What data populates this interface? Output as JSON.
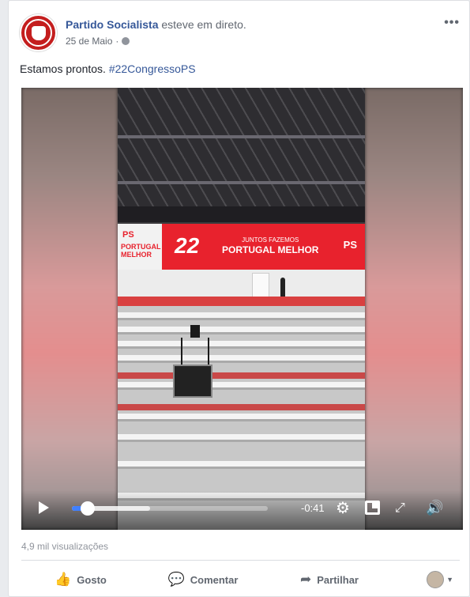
{
  "post": {
    "author": "Partido Socialista",
    "action": "esteve em direto.",
    "date": "25 de Maio",
    "date_sep": "·",
    "more": "•••",
    "text_plain": "Estamos prontos. ",
    "hashtag": "#22CongressoPS"
  },
  "video": {
    "banner_number": "22",
    "banner_small": "JUNTOS FAZEMOS",
    "banner_big": "PORTUGAL MELHOR",
    "banner_ps": "PS",
    "side_ps": "PS",
    "side_text": "PORTUGAL MELHOR",
    "time_remaining": "-0:41",
    "progress_played": 0.08,
    "progress_buffered": 0.4
  },
  "stats": {
    "views": "4,9 mil visualizações"
  },
  "actions": {
    "like": "Gosto",
    "comment": "Comentar",
    "share": "Partilhar"
  },
  "icons": {
    "play": "play-icon",
    "settings": "gear-icon",
    "pip": "picture-in-picture-icon",
    "fullscreen": "fullscreen-icon",
    "volume": "volume-icon",
    "like": "thumbs-up-icon",
    "comment": "comment-icon",
    "share": "share-arrow-icon",
    "globe": "globe-icon"
  },
  "colors": {
    "link": "#365899",
    "brand_red": "#e8222d",
    "progress": "#4080ff"
  }
}
